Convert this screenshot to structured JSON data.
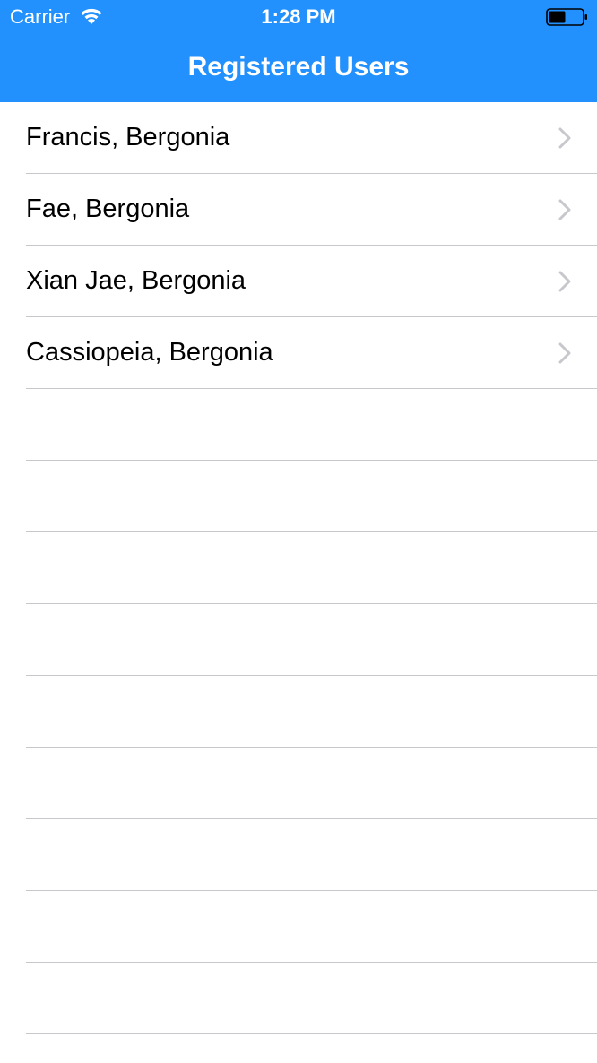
{
  "status_bar": {
    "carrier": "Carrier",
    "time": "1:28 PM",
    "wifi_icon": "wifi-icon",
    "battery_icon": "battery-icon",
    "battery_level": 0.5
  },
  "navbar": {
    "title": "Registered Users",
    "background_color": "#2391fd"
  },
  "users": [
    {
      "label": "Francis, Bergonia",
      "icon": "chevron-right-icon"
    },
    {
      "label": "Fae, Bergonia",
      "icon": "chevron-right-icon"
    },
    {
      "label": "Xian Jae, Bergonia",
      "icon": "chevron-right-icon"
    },
    {
      "label": "Cassiopeia, Bergonia",
      "icon": "chevron-right-icon"
    }
  ],
  "colors": {
    "separator": "#c8c7cc",
    "chevron": "#c7c7cc"
  }
}
